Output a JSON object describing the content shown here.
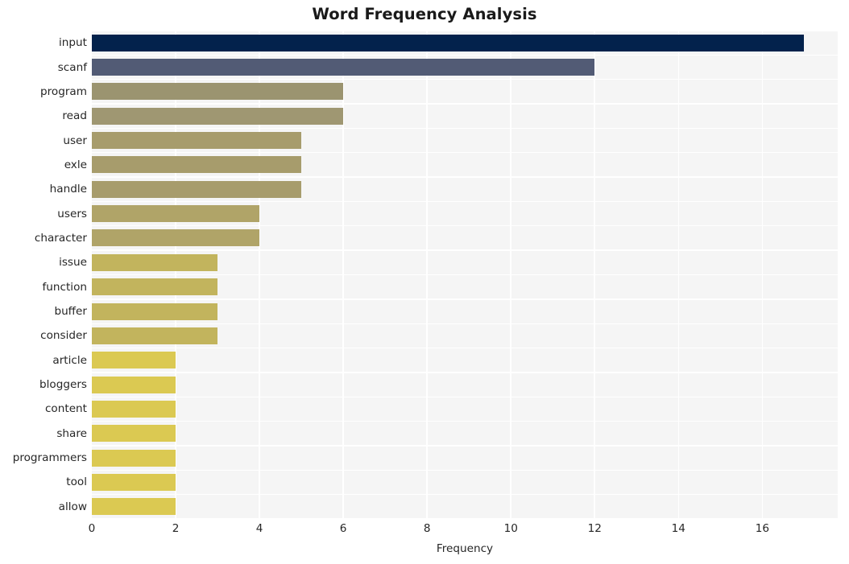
{
  "chart_data": {
    "type": "bar",
    "orientation": "horizontal",
    "title": "Word Frequency Analysis",
    "xlabel": "Frequency",
    "ylabel": "",
    "categories": [
      "input",
      "scanf",
      "program",
      "read",
      "user",
      "exle",
      "handle",
      "users",
      "character",
      "issue",
      "function",
      "buffer",
      "consider",
      "article",
      "bloggers",
      "content",
      "share",
      "programmers",
      "tool",
      "allow"
    ],
    "values": [
      17,
      12,
      6,
      6,
      5,
      5,
      5,
      4,
      4,
      3,
      3,
      3,
      3,
      2,
      2,
      2,
      2,
      2,
      2,
      2
    ],
    "bar_colors": [
      "#03224c",
      "#525b75",
      "#9b9470",
      "#9f9772",
      "#a79c6c",
      "#a79c6c",
      "#a79c6c",
      "#b0a468",
      "#b0a468",
      "#c2b45d",
      "#c2b45d",
      "#c2b45d",
      "#c2b45d",
      "#dbc952",
      "#dbc952",
      "#dbc952",
      "#dbc952",
      "#dbc952",
      "#dbc952",
      "#dbc952"
    ],
    "xticks": [
      0,
      2,
      4,
      6,
      8,
      10,
      12,
      14,
      16
    ],
    "xlim": [
      0,
      17.8
    ],
    "grid": true,
    "grid_color": "#ffffff",
    "plot_background": "#f5f5f5",
    "legend": null
  }
}
